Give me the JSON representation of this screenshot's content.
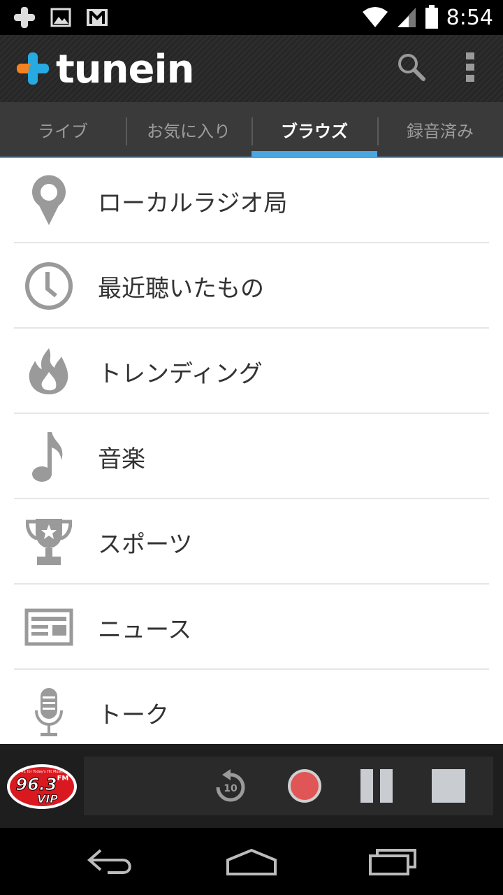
{
  "status_bar": {
    "time": "8:54",
    "icons": [
      "tunein-notification-icon",
      "image-notification-icon",
      "gmail-notification-icon",
      "wifi-icon",
      "signal-icon",
      "battery-icon"
    ]
  },
  "app_bar": {
    "logo_text": "tunein",
    "actions": [
      "search-icon",
      "overflow-menu-icon"
    ]
  },
  "tabs": [
    {
      "label": "ライブ",
      "active": false
    },
    {
      "label": "お気に入り",
      "active": false
    },
    {
      "label": "ブラウズ",
      "active": true
    },
    {
      "label": "録音済み",
      "active": false
    }
  ],
  "browse": {
    "items": [
      {
        "label": "ローカルラジオ局",
        "icon": "location-pin-icon"
      },
      {
        "label": "最近聴いたもの",
        "icon": "clock-icon"
      },
      {
        "label": "トレンディング",
        "icon": "flame-icon"
      },
      {
        "label": "音楽",
        "icon": "music-note-icon"
      },
      {
        "label": "スポーツ",
        "icon": "trophy-icon"
      },
      {
        "label": "ニュース",
        "icon": "newspaper-icon"
      },
      {
        "label": "トーク",
        "icon": "microphone-icon"
      }
    ]
  },
  "player": {
    "station": {
      "tagline": "#1 for Today's Hit Music",
      "frequency": "96.3",
      "band": "FM",
      "name": "VIP"
    },
    "rewind_seconds": "10",
    "controls": [
      "rewind-10-icon",
      "record-icon",
      "pause-icon",
      "stop-icon"
    ]
  },
  "nav_bar": {
    "buttons": [
      "back-icon",
      "home-icon",
      "recent-apps-icon"
    ]
  },
  "colors": {
    "accent": "#4aa6e0",
    "record": "#e05555",
    "icon_gray": "#9a9a9a",
    "logo_orange": "#f58220",
    "logo_blue": "#27a9e1"
  }
}
